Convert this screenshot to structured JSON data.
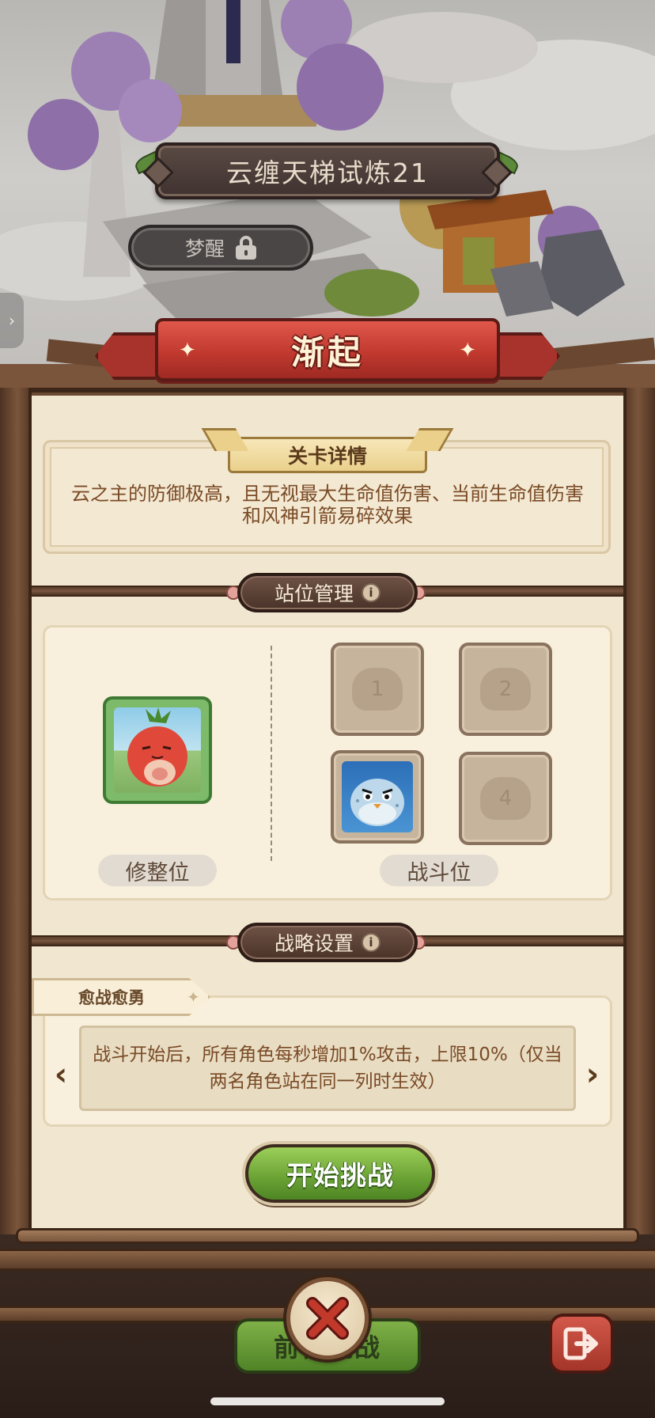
{
  "stage": {
    "title": "云缠天梯试炼21",
    "mode_label": "梦醒"
  },
  "banner": {
    "title": "渐起"
  },
  "details": {
    "header": "关卡详情",
    "description": "云之主的防御极高，且无视最大生命值伤害、当前生命值伤害和风神引箭易碎效果"
  },
  "formation": {
    "header": "站位管理",
    "info_glyph": "i",
    "slots": [
      "1",
      "2",
      "4"
    ],
    "reserve_label": "修整位",
    "battle_label": "战斗位"
  },
  "strategy": {
    "header": "战略设置",
    "info_glyph": "i",
    "name": "愈战愈勇",
    "description": "战斗开始后，所有角色每秒增加1%攻击，上限10%（仅当两名角色站在同一列时生效）",
    "prev_glyph": "‹",
    "next_glyph": "›"
  },
  "actions": {
    "start": "开始挑战",
    "go": "前往挑战"
  },
  "colors": {
    "ribbon_red": "#c2392f",
    "start_green": "#6ea536",
    "panel_cream": "#f1e6cf",
    "frame_wood": "#6b4a34",
    "close_red": "#c0392b"
  },
  "icons": {
    "mode": "lock-icon",
    "close": "close-x-icon",
    "exit": "exit-door-icon",
    "side": "chevron-right-icon"
  }
}
